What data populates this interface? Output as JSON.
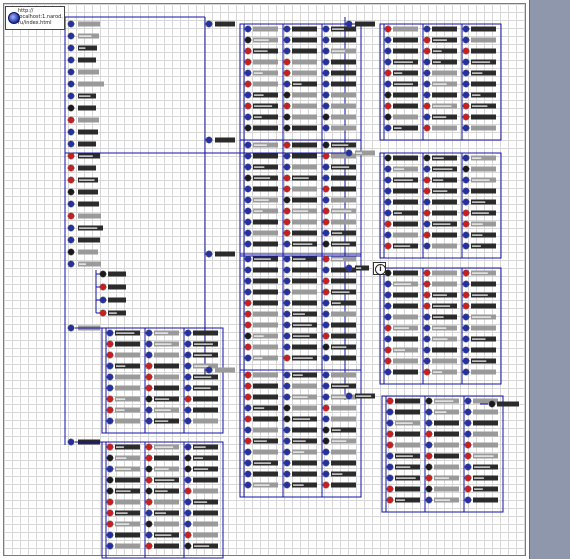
{
  "root": {
    "lines": [
      "http://",
      "localhost:1.narod.",
      "ru/index.html"
    ],
    "icon": "globe-icon"
  },
  "info_badge": {
    "label": "i",
    "icon": "info-icon"
  },
  "colors": {
    "edge": "#1010a8",
    "node_blue": "#2430a0",
    "node_red": "#c81e1e",
    "node_dark": "#1a1a1a",
    "label_dark": "#2b2b2b",
    "label_gray": "#9a9a9a",
    "canvas_grid": "#d7d7d7"
  }
}
